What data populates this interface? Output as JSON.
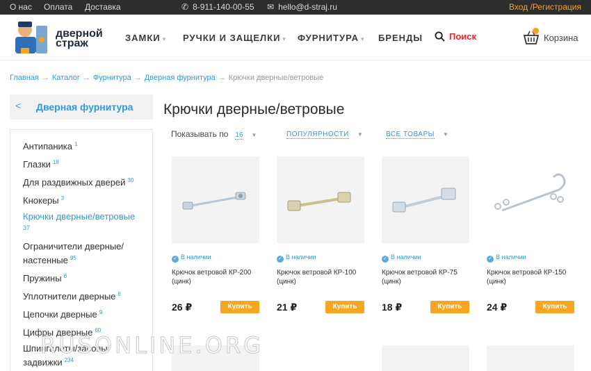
{
  "topbar": {
    "about": "О нас",
    "payment": "Оплата",
    "delivery": "Доставка",
    "phone": "8-911-140-00-55",
    "email": "hello@d-straj.ru",
    "login": "Вход /Регистрация"
  },
  "header": {
    "logo_line1": "дверной",
    "logo_line2": "страж",
    "nav": [
      "ЗАМКИ",
      "РУЧКИ И ЗАЩЕЛКИ",
      "ФУРНИТУРА",
      "БРЕНДЫ"
    ],
    "search_label": "Поиск",
    "cart_label": "Корзина"
  },
  "breadcrumb": [
    "Главная",
    "Каталог",
    "Фурнитура",
    "Дверная фурнитура",
    "Крючки дверные/ветровые"
  ],
  "sidebar": {
    "title": "Дверная фурнитура",
    "items": [
      {
        "label": "Антипаника",
        "count": "1"
      },
      {
        "label": "Глазки",
        "count": "18"
      },
      {
        "label": "Для раздвижных дверей",
        "count": "30"
      },
      {
        "label": "Кнокеры",
        "count": "3"
      },
      {
        "label": "Крючки дверные/ветровые",
        "count": "37"
      },
      {
        "label": "Ограничители дверные/ настенные",
        "count": "95"
      },
      {
        "label": "Пружины",
        "count": "6"
      },
      {
        "label": "Уплотнители дверные",
        "count": "8"
      },
      {
        "label": "Цепочки дверные",
        "count": "9"
      },
      {
        "label": "Цифры дверные",
        "count": "60"
      },
      {
        "label": "Шпингалеты/засовы/ задвижки",
        "count": "234"
      }
    ]
  },
  "main": {
    "title": "Крючки дверные/ветровые",
    "show_label": "Показывать по",
    "show_value": "16",
    "sort_value": "ПОПУЛЯРНОСТИ",
    "filter_value": "ВСЕ ТОВАРЫ"
  },
  "products": [
    {
      "stock": "В наличии",
      "name": "Крючок ветровой КР-200 (цинк)",
      "price": "26 ₽",
      "buy": "Купить"
    },
    {
      "stock": "В наличии",
      "name": "Крючок ветровой КР-100 (цинк)",
      "price": "21 ₽",
      "buy": "Купить"
    },
    {
      "stock": "В наличии",
      "name": "Крючок ветровой КР-75 (цинк)",
      "price": "18 ₽",
      "buy": "Купить"
    },
    {
      "stock": "В наличии",
      "name": "Крючок ветровой КР-150 (цинк)",
      "price": "24 ₽",
      "buy": "Купить"
    }
  ],
  "watermark": "RUSONLINE.ORG",
  "colors": {
    "accent": "#2f9ad8",
    "button": "#f6a623",
    "search": "#e3262b",
    "topbar": "#2d2d2d",
    "login": "#f0a521"
  }
}
